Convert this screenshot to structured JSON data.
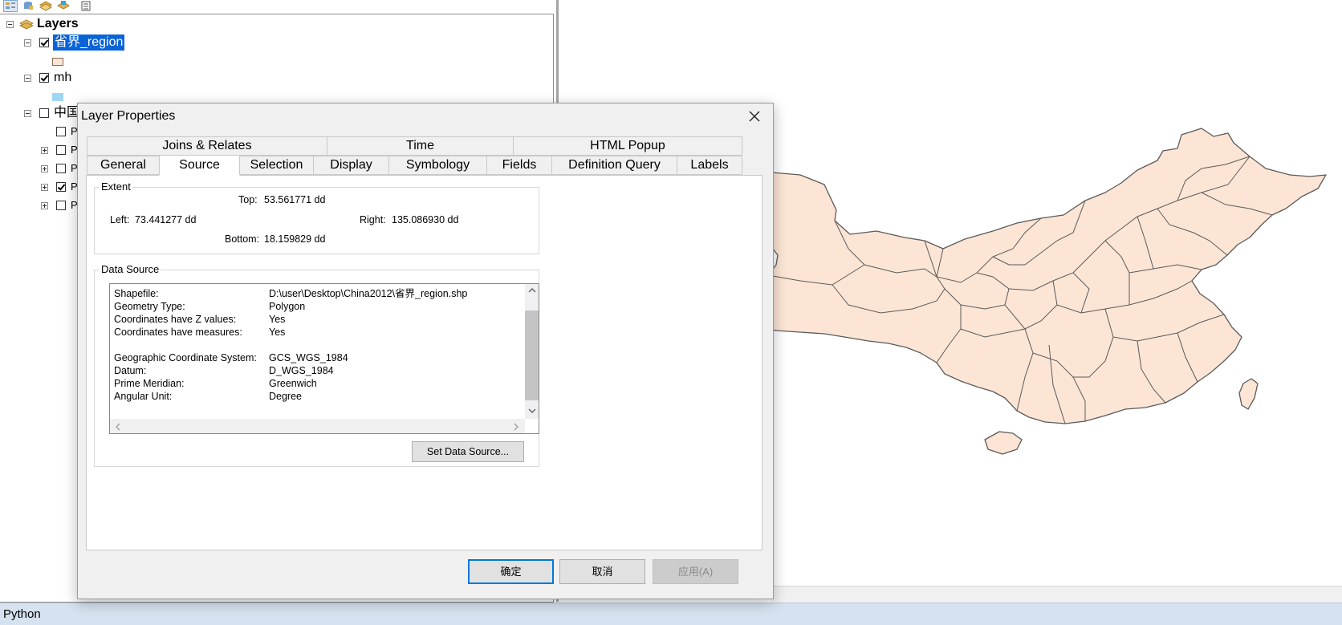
{
  "toc": {
    "root_label": "Layers",
    "layers": [
      {
        "label": "省界_region",
        "checked": true,
        "selected": true,
        "swatch": "#fbe5d6"
      },
      {
        "label": "mh",
        "checked": true,
        "swatch": "#9fd7f2"
      },
      {
        "label": "中国",
        "checked": false
      }
    ],
    "sublayer_prefix": "P"
  },
  "colors": {
    "map_fill": "#fce5d5",
    "map_stroke": "#5a5a5a",
    "selection": "#0a64d8",
    "primary_border": "#0078d7"
  },
  "dialog": {
    "title": "Layer Properties",
    "tabs_row1": [
      "Joins & Relates",
      "Time",
      "HTML Popup"
    ],
    "tabs_row2": [
      "General",
      "Source",
      "Selection",
      "Display",
      "Symbology",
      "Fields",
      "Definition Query",
      "Labels"
    ],
    "active_tab": "Source",
    "extent": {
      "title": "Extent",
      "top_label": "Top:",
      "top_value": "53.561771 dd",
      "left_label": "Left:",
      "left_value": "73.441277 dd",
      "right_label": "Right:",
      "right_value": "135.086930 dd",
      "bottom_label": "Bottom:",
      "bottom_value": "18.159829 dd"
    },
    "data_source": {
      "title": "Data Source",
      "rows": [
        {
          "key": "Shapefile:",
          "value": "D:\\user\\Desktop\\China2012\\省界_region.shp"
        },
        {
          "key": "Geometry Type:",
          "value": "Polygon"
        },
        {
          "key": "Coordinates have Z values:",
          "value": "Yes"
        },
        {
          "key": "Coordinates have measures:",
          "value": "Yes"
        },
        {
          "key": "",
          "value": ""
        },
        {
          "key": "Geographic Coordinate System:",
          "value": "GCS_WGS_1984"
        },
        {
          "key": "Datum:",
          "value": "D_WGS_1984"
        },
        {
          "key": "Prime Meridian:",
          "value": "Greenwich"
        },
        {
          "key": "Angular Unit:",
          "value": "Degree"
        }
      ],
      "set_button": "Set Data Source..."
    },
    "buttons": {
      "ok": "确定",
      "cancel": "取消",
      "apply": "应用(A)"
    }
  },
  "status": {
    "text": "Python"
  }
}
